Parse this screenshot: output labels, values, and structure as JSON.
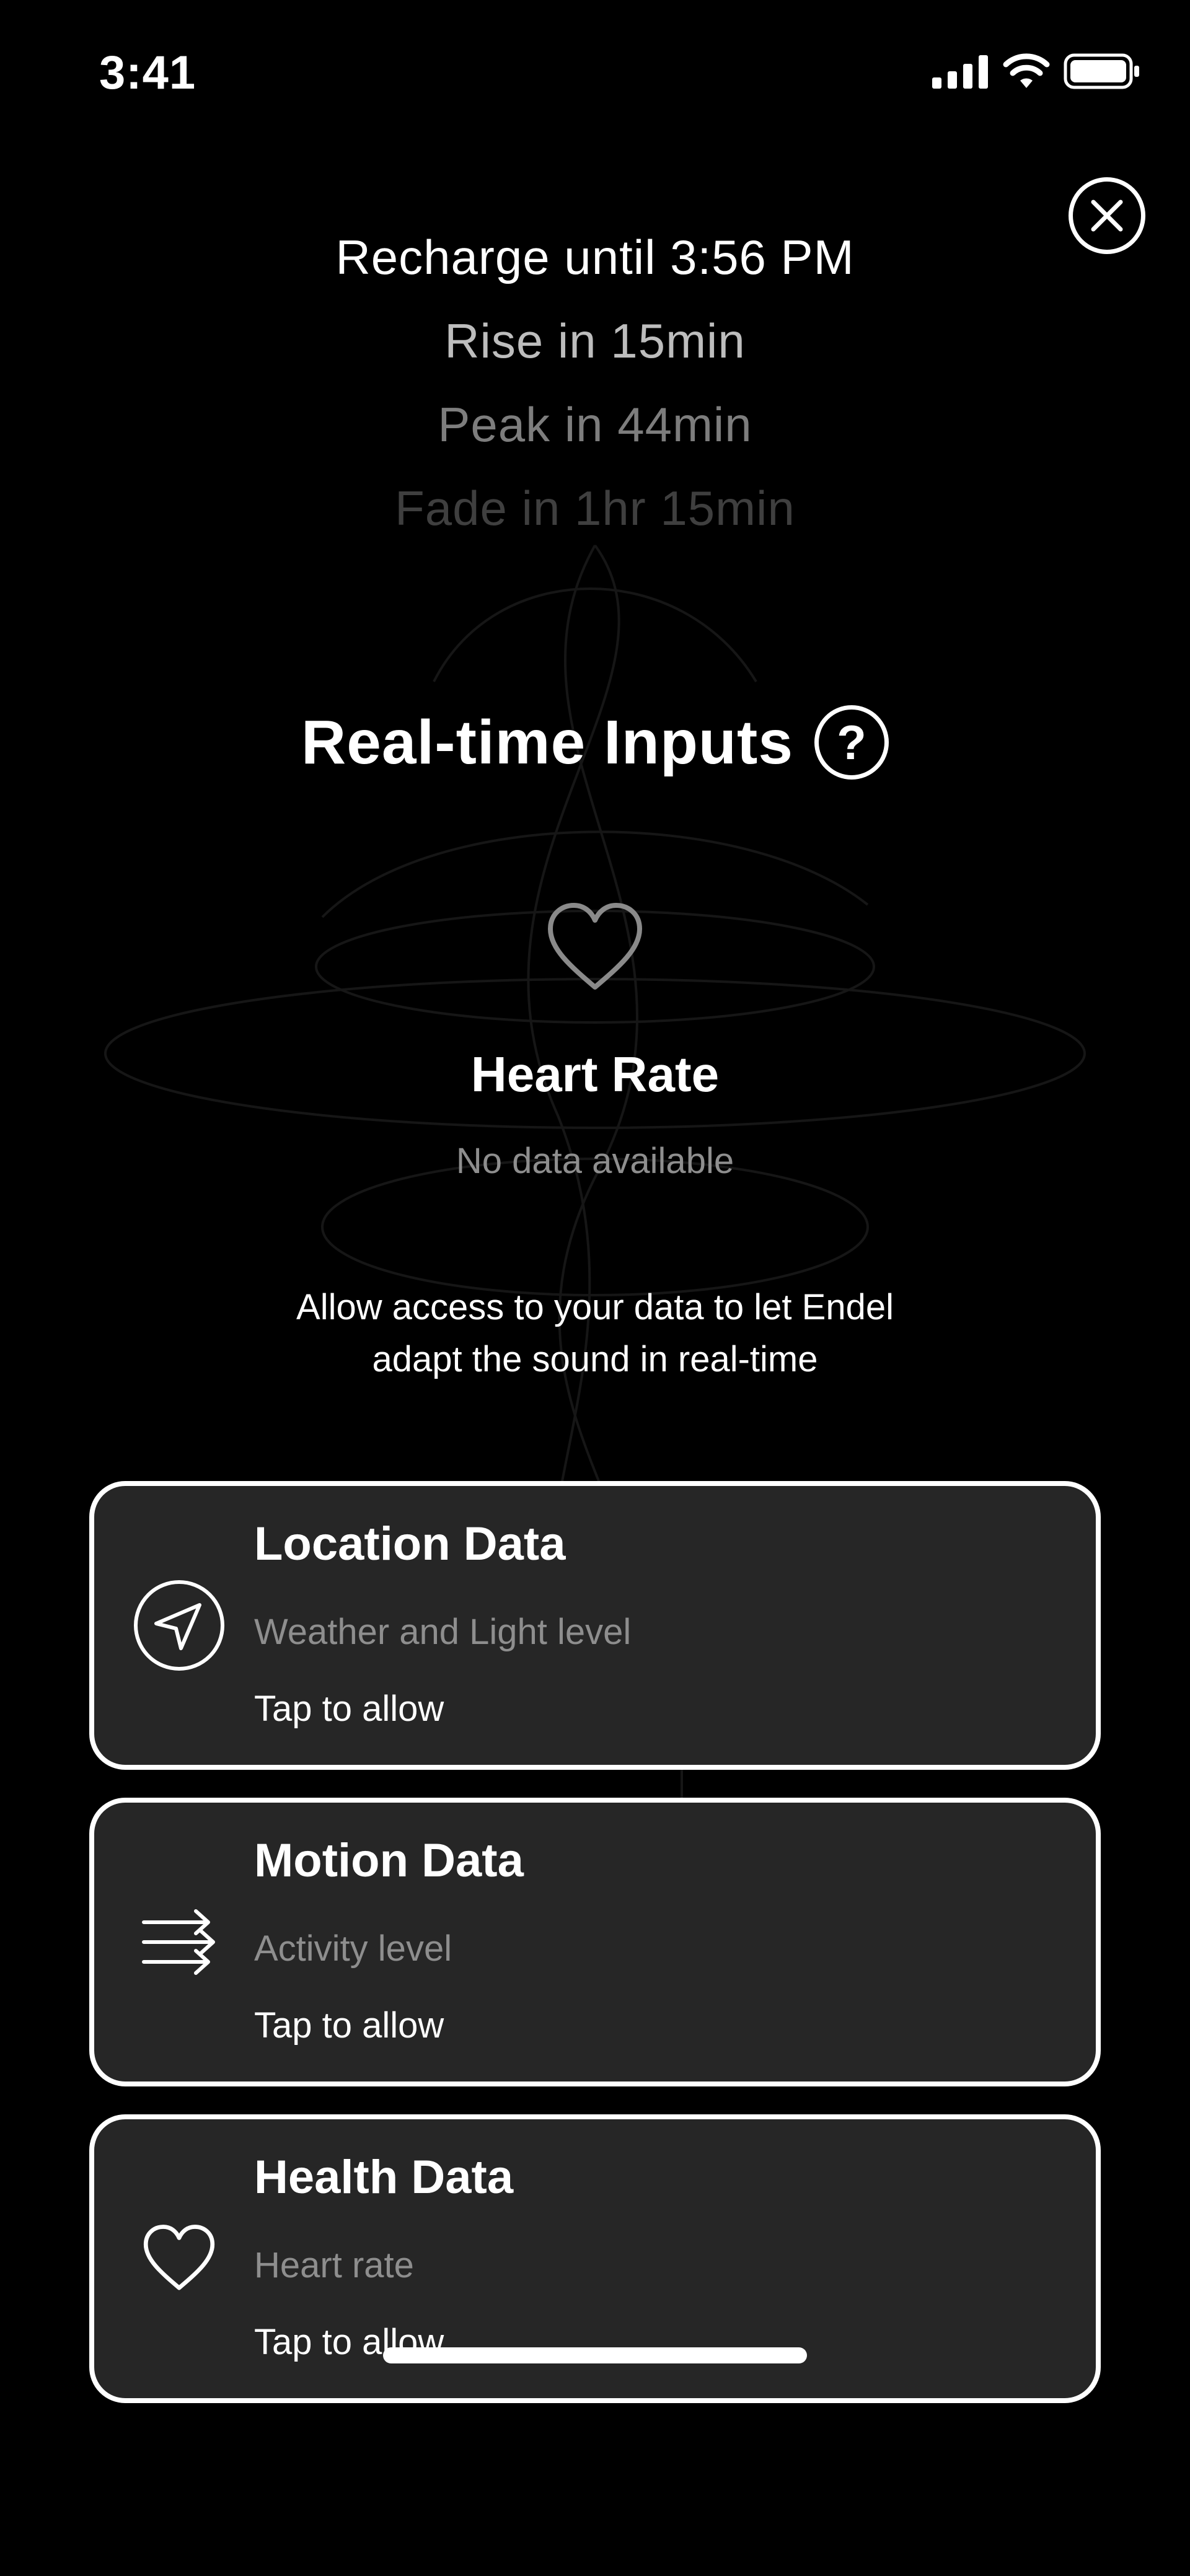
{
  "status_bar": {
    "time": "3:41",
    "icons": [
      "cellular-signal-icon",
      "wifi-icon",
      "battery-icon"
    ]
  },
  "close_icon": "close-icon",
  "schedule": {
    "line1": "Recharge until 3:56 PM",
    "line2": "Rise in 15min",
    "line3": "Peak in 44min",
    "line4": "Fade in 1hr 15min"
  },
  "realtime": {
    "title": "Real-time Inputs",
    "help_glyph": "?"
  },
  "heart_rate": {
    "icon": "heart-icon",
    "title": "Heart Rate",
    "status": "No data available"
  },
  "allow_message": {
    "line1": "Allow access to your data to let Endel",
    "line2": "adapt the sound in real-time"
  },
  "cards": [
    {
      "icon": "location-arrow-icon",
      "title": "Location Data",
      "subtitle": "Weather and Light level",
      "cta": "Tap to allow"
    },
    {
      "icon": "motion-arrows-icon",
      "title": "Motion Data",
      "subtitle": "Activity level",
      "cta": "Tap to allow"
    },
    {
      "icon": "heart-icon",
      "title": "Health Data",
      "subtitle": "Heart rate",
      "cta": "Tap to allow"
    }
  ],
  "colors": {
    "background": "#000000",
    "card_background": "#262626",
    "text_primary": "#ffffff",
    "text_secondary": "#8e8e8e"
  }
}
